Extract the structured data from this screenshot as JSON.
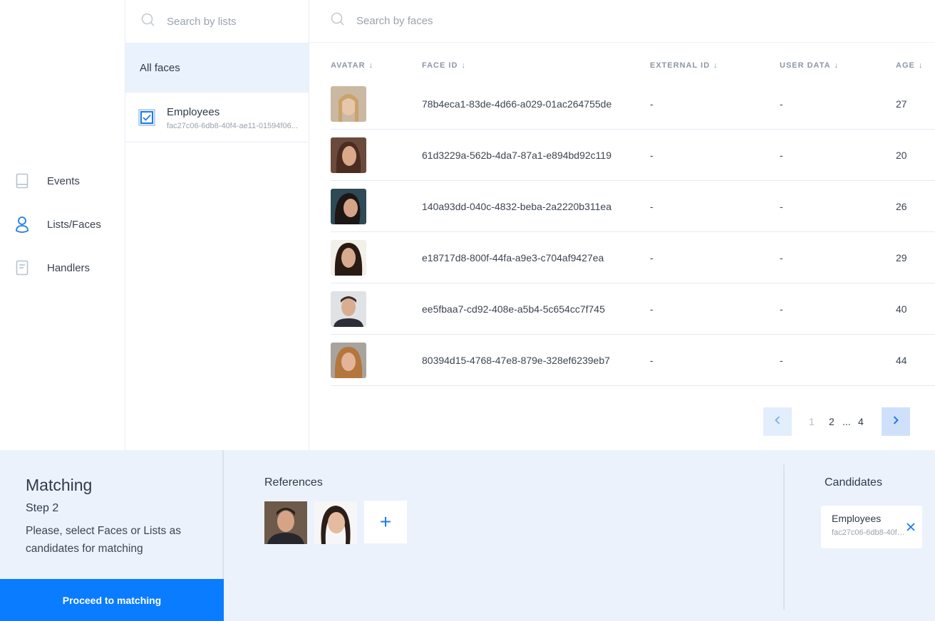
{
  "nav": {
    "items": [
      {
        "label": "Events",
        "icon": "book-icon"
      },
      {
        "label": "Lists/Faces",
        "icon": "user-icon"
      },
      {
        "label": "Handlers",
        "icon": "document-icon"
      }
    ],
    "active_color": "#1e7be8"
  },
  "lists_panel": {
    "search_placeholder": "Search by lists",
    "all_faces_label": "All faces",
    "lists": [
      {
        "name": "Employees",
        "id": "fac27c06-6db8-40f4-ae11-01594f06...",
        "checked": true
      }
    ]
  },
  "faces_panel": {
    "search_placeholder": "Search by faces",
    "columns": [
      "AVATAR",
      "FACE ID",
      "EXTERNAL ID",
      "USER DATA",
      "AGE"
    ],
    "rows": [
      {
        "face_id": "78b4eca1-83de-4d66-a029-01ac264755de",
        "external_id": "-",
        "user_data": "-",
        "age": "27"
      },
      {
        "face_id": "61d3229a-562b-4da7-87a1-e894bd92c119",
        "external_id": "-",
        "user_data": "-",
        "age": "20"
      },
      {
        "face_id": "140a93dd-040c-4832-beba-2a2220b311ea",
        "external_id": "-",
        "user_data": "-",
        "age": "26"
      },
      {
        "face_id": "e18717d8-800f-44fa-a9e3-c704af9427ea",
        "external_id": "-",
        "user_data": "-",
        "age": "29"
      },
      {
        "face_id": "ee5fbaa7-cd92-408e-a5b4-5c654cc7f745",
        "external_id": "-",
        "user_data": "-",
        "age": "40"
      },
      {
        "face_id": "80394d15-4768-47e8-879e-328ef6239eb7",
        "external_id": "-",
        "user_data": "-",
        "age": "44"
      }
    ],
    "pagination": {
      "pages": [
        "1",
        "2",
        "...",
        "4"
      ],
      "current": "1"
    }
  },
  "matching": {
    "title": "Matching",
    "step": "Step 2",
    "description": "Please, select Faces or Lists as candidates for matching",
    "proceed_label": "Proceed to matching",
    "references_title": "References",
    "add_reference_symbol": "+",
    "candidates_title": "Candidates",
    "candidates": [
      {
        "name": "Employees",
        "id": "fac27c06-6db8-40f4-ae11-01594f06..."
      }
    ]
  }
}
